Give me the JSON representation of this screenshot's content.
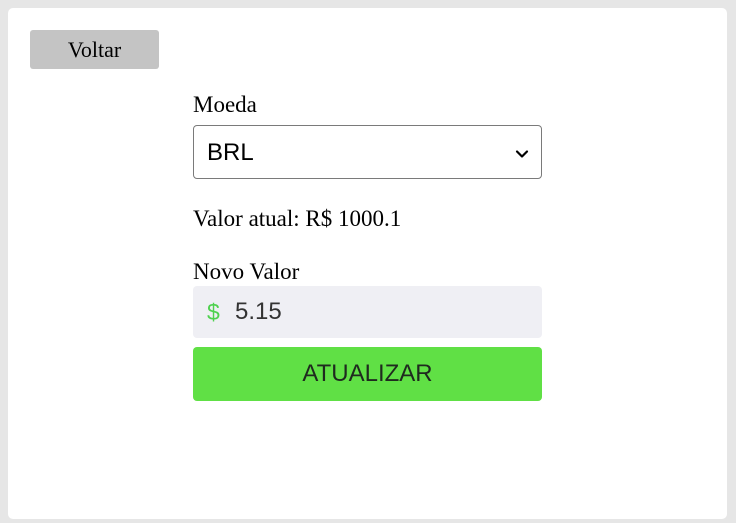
{
  "back_button": {
    "label": "Voltar"
  },
  "currency": {
    "label": "Moeda",
    "selected": "BRL"
  },
  "current_value": {
    "text": "Valor atual: R$ 1000.1"
  },
  "new_value": {
    "label": "Novo Valor",
    "icon": "dollar-icon",
    "value": "5.15"
  },
  "update_button": {
    "label": "ATUALIZAR"
  },
  "colors": {
    "page_bg": "#e6e6e6",
    "card_bg": "#ffffff",
    "back_button_bg": "#c4c4c4",
    "input_bg": "#efeff4",
    "accent_green": "#60e045",
    "dollar_icon": "#4fd14f"
  }
}
